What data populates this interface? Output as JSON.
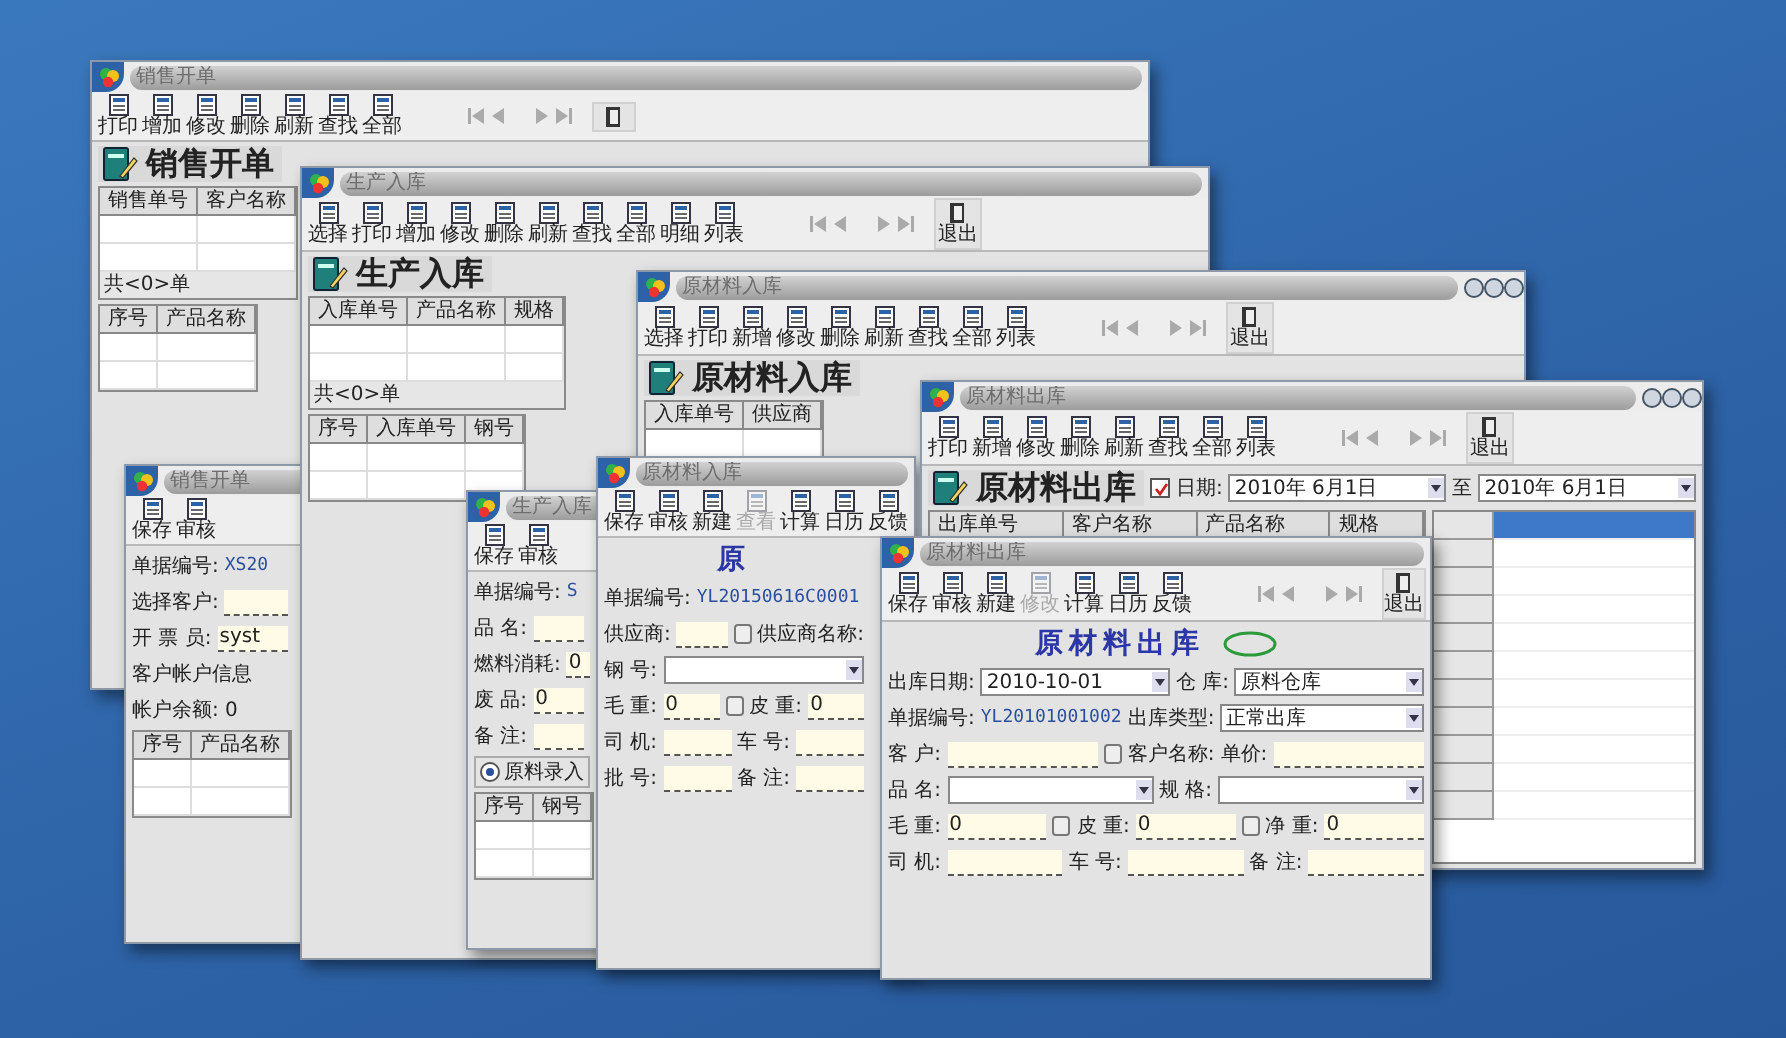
{
  "windows": [
    {
      "title": "销售开单",
      "controls": false,
      "sections": [
        {
          "kind": "toolbar",
          "items": [
            {
              "kind": "button",
              "label": "打印"
            },
            {
              "kind": "button",
              "label": "增加"
            },
            {
              "kind": "button",
              "label": "修改"
            },
            {
              "kind": "button",
              "label": "删除"
            },
            {
              "kind": "button",
              "label": "刷新"
            },
            {
              "kind": "button",
              "label": "查找"
            },
            {
              "kind": "button",
              "label": "全部"
            },
            {
              "kind": "nav"
            },
            {
              "kind": "exit"
            }
          ]
        },
        {
          "kind": "heading",
          "text": "销售开单"
        },
        {
          "kind": "grid",
          "columns": [
            "销售单号",
            "客户名称"
          ],
          "footer": "共<0>单"
        },
        {
          "kind": "grid",
          "columns": [
            "序号",
            "产品名称"
          ]
        }
      ]
    },
    {
      "title": "销售开单",
      "controls": false,
      "sections": [
        {
          "kind": "toolbar",
          "items": [
            {
              "kind": "button",
              "label": "保存"
            },
            {
              "kind": "button",
              "label": "审核"
            }
          ]
        },
        {
          "kind": "fields",
          "rows": [
            {
              "items": [
                {
                  "kind": "label",
                  "text": "单据编号:"
                },
                {
                  "kind": "value",
                  "text": "XS20"
                }
              ]
            },
            {
              "items": [
                {
                  "kind": "label",
                  "text": "选择客户:"
                },
                {
                  "kind": "input"
                }
              ]
            },
            {
              "items": [
                {
                  "kind": "label",
                  "text": "开 票 员:"
                },
                {
                  "kind": "input",
                  "value": "syst"
                }
              ]
            },
            {
              "items": [
                {
                  "kind": "label",
                  "text": "客户帐户信息"
                }
              ]
            },
            {
              "items": [
                {
                  "kind": "label",
                  "text": "帐户余额: 0"
                }
              ]
            }
          ]
        },
        {
          "kind": "grid",
          "columns": [
            "序号",
            "产品名称"
          ]
        }
      ]
    },
    {
      "title": "生产入库",
      "controls": false,
      "sections": [
        {
          "kind": "toolbar",
          "items": [
            {
              "kind": "button",
              "label": "选择"
            },
            {
              "kind": "button",
              "label": "打印"
            },
            {
              "kind": "button",
              "label": "增加"
            },
            {
              "kind": "button",
              "label": "修改"
            },
            {
              "kind": "button",
              "label": "删除"
            },
            {
              "kind": "button",
              "label": "刷新"
            },
            {
              "kind": "button",
              "label": "查找"
            },
            {
              "kind": "button",
              "label": "全部"
            },
            {
              "kind": "button",
              "label": "明细"
            },
            {
              "kind": "button",
              "label": "列表"
            },
            {
              "kind": "nav"
            },
            {
              "kind": "exit",
              "label": "退出"
            }
          ]
        },
        {
          "kind": "heading",
          "text": "生产入库"
        },
        {
          "kind": "grid",
          "columns": [
            "入库单号",
            "产品名称",
            "规格"
          ],
          "footer": "共<0>单"
        },
        {
          "kind": "grid",
          "columns": [
            "序号",
            "入库单号",
            "钢号"
          ]
        }
      ]
    },
    {
      "title": "生产入库",
      "controls": false,
      "sections": [
        {
          "kind": "toolbar",
          "items": [
            {
              "kind": "button",
              "label": "保存"
            },
            {
              "kind": "button",
              "label": "审核"
            }
          ]
        },
        {
          "kind": "fields",
          "rows": [
            {
              "items": [
                {
                  "kind": "label",
                  "text": "单据编号:"
                },
                {
                  "kind": "value",
                  "text": "S"
                }
              ]
            },
            {
              "items": [
                {
                  "kind": "label",
                  "text": "品 名:"
                },
                {
                  "kind": "input"
                }
              ]
            },
            {
              "items": [
                {
                  "kind": "label",
                  "text": "燃料消耗:"
                },
                {
                  "kind": "input",
                  "value": "0"
                }
              ]
            },
            {
              "items": [
                {
                  "kind": "label",
                  "text": "废 品:"
                },
                {
                  "kind": "input",
                  "value": "0"
                }
              ]
            },
            {
              "items": [
                {
                  "kind": "label",
                  "text": "备 注:"
                },
                {
                  "kind": "input"
                }
              ]
            }
          ]
        },
        {
          "kind": "radio",
          "label": "原料录入",
          "checked": true
        },
        {
          "kind": "grid",
          "columns": [
            "序号",
            "钢号"
          ]
        }
      ]
    },
    {
      "title": "原材料入库",
      "controls": true,
      "sections": [
        {
          "kind": "toolbar",
          "items": [
            {
              "kind": "button",
              "label": "选择"
            },
            {
              "kind": "button",
              "label": "打印"
            },
            {
              "kind": "button",
              "label": "新增"
            },
            {
              "kind": "button",
              "label": "修改"
            },
            {
              "kind": "button",
              "label": "删除"
            },
            {
              "kind": "button",
              "label": "刷新"
            },
            {
              "kind": "button",
              "label": "查找"
            },
            {
              "kind": "button",
              "label": "全部"
            },
            {
              "kind": "button",
              "label": "列表"
            },
            {
              "kind": "nav"
            },
            {
              "kind": "exit",
              "label": "退出"
            }
          ]
        },
        {
          "kind": "heading",
          "text": "原材料入库"
        },
        {
          "kind": "grid",
          "columns": [
            "入库单号",
            "供应商"
          ]
        }
      ]
    },
    {
      "title": "原材料入库",
      "controls": false,
      "sections": [
        {
          "kind": "toolbar",
          "items": [
            {
              "kind": "button",
              "label": "保存",
              "disabled": false
            },
            {
              "kind": "button",
              "label": "审核",
              "disabled": false
            },
            {
              "kind": "button",
              "label": "新建",
              "disabled": false
            },
            {
              "kind": "button",
              "label": "查看",
              "disabled": true
            },
            {
              "kind": "button",
              "label": "计算",
              "disabled": false
            },
            {
              "kind": "button",
              "label": "日历",
              "disabled": false
            },
            {
              "kind": "button",
              "label": "反馈",
              "disabled": false
            }
          ]
        },
        {
          "kind": "form_title",
          "text": "原",
          "stamp": false
        },
        {
          "kind": "fields",
          "rows": [
            {
              "items": [
                {
                  "kind": "label",
                  "text": "单据编号:"
                },
                {
                  "kind": "value",
                  "text": "YL20150616C0001"
                }
              ]
            },
            {
              "items": [
                {
                  "kind": "label",
                  "text": "供应商:"
                },
                {
                  "kind": "input"
                },
                {
                  "kind": "button"
                },
                {
                  "kind": "label",
                  "text": "供应商名称:"
                }
              ]
            },
            {
              "items": [
                {
                  "kind": "label",
                  "text": "钢 号:"
                },
                {
                  "kind": "select"
                }
              ]
            },
            {
              "items": [
                {
                  "kind": "label",
                  "text": "毛 重:"
                },
                {
                  "kind": "input",
                  "value": "0"
                },
                {
                  "kind": "button"
                },
                {
                  "kind": "label",
                  "text": "皮 重:"
                },
                {
                  "kind": "input",
                  "value": "0"
                }
              ]
            },
            {
              "items": [
                {
                  "kind": "label",
                  "text": "司 机:"
                },
                {
                  "kind": "input"
                },
                {
                  "kind": "label",
                  "text": "车 号:"
                },
                {
                  "kind": "input"
                }
              ]
            },
            {
              "items": [
                {
                  "kind": "label",
                  "text": "批 号:"
                },
                {
                  "kind": "input"
                },
                {
                  "kind": "label",
                  "text": "备 注:"
                },
                {
                  "kind": "input"
                }
              ]
            }
          ]
        }
      ]
    },
    {
      "title": "原材料出库",
      "controls": true,
      "sections": [
        {
          "kind": "toolbar",
          "items": [
            {
              "kind": "button",
              "label": "打印"
            },
            {
              "kind": "button",
              "label": "新增"
            },
            {
              "kind": "button",
              "label": "修改"
            },
            {
              "kind": "button",
              "label": "删除"
            },
            {
              "kind": "button",
              "label": "刷新"
            },
            {
              "kind": "button",
              "label": "查找"
            },
            {
              "kind": "button",
              "label": "全部"
            },
            {
              "kind": "button",
              "label": "列表"
            },
            {
              "kind": "nav"
            },
            {
              "kind": "exit",
              "label": "退出"
            }
          ]
        },
        {
          "kind": "fields",
          "rows": [
            {
              "items": [
                {
                  "kind": "heading",
                  "text": "原材料出库"
                },
                {
                  "kind": "checkbox",
                  "text": "日期:",
                  "checked": true
                },
                {
                  "kind": "select",
                  "value": "2010年 6月1日"
                },
                {
                  "kind": "label",
                  "text": "至"
                },
                {
                  "kind": "select",
                  "value": "2010年 6月1日"
                }
              ]
            }
          ]
        },
        {
          "kind": "split",
          "columns": [
            "出库单号",
            "客户名称",
            "产品名称",
            "规格"
          ],
          "side": [
            {
              "selected": true
            },
            {
              "selected": false
            },
            {
              "selected": false
            },
            {
              "selected": false
            },
            {
              "selected": false
            },
            {
              "selected": false
            },
            {
              "selected": false
            },
            {
              "selected": false
            },
            {
              "selected": false
            },
            {
              "selected": false
            },
            {
              "selected": false
            }
          ]
        }
      ]
    },
    {
      "title": "原材料出库",
      "controls": false,
      "sections": [
        {
          "kind": "toolbar",
          "items": [
            {
              "kind": "button",
              "label": "保存",
              "disabled": false
            },
            {
              "kind": "button",
              "label": "审核",
              "disabled": false
            },
            {
              "kind": "button",
              "label": "新建",
              "disabled": false
            },
            {
              "kind": "button",
              "label": "修改",
              "disabled": true
            },
            {
              "kind": "button",
              "label": "计算",
              "disabled": false
            },
            {
              "kind": "button",
              "label": "日历",
              "disabled": false
            },
            {
              "kind": "button",
              "label": "反馈",
              "disabled": false
            },
            {
              "kind": "nav"
            },
            {
              "kind": "exit",
              "label": "退出"
            }
          ]
        },
        {
          "kind": "form_title",
          "text": "原材料出库",
          "stamp": true
        },
        {
          "kind": "fields",
          "rows": [
            {
              "items": [
                {
                  "kind": "label",
                  "text": "出库日期:"
                },
                {
                  "kind": "select",
                  "value": "2010-10-01"
                },
                {
                  "kind": "label",
                  "text": "仓 库:"
                },
                {
                  "kind": "select",
                  "value": "原料仓库"
                }
              ]
            },
            {
              "items": [
                {
                  "kind": "label",
                  "text": "单据编号:"
                },
                {
                  "kind": "value",
                  "text": "YL20101001002"
                },
                {
                  "kind": "label",
                  "text": "出库类型:"
                },
                {
                  "kind": "select",
                  "value": "正常出库"
                }
              ]
            },
            {
              "items": [
                {
                  "kind": "label",
                  "text": "客 户:"
                },
                {
                  "kind": "input"
                },
                {
                  "kind": "button"
                },
                {
                  "kind": "label",
                  "text": "客户名称:"
                },
                {
                  "kind": "label",
                  "text": "单价:"
                },
                {
                  "kind": "input"
                }
              ]
            },
            {
              "items": [
                {
                  "kind": "label",
                  "text": "品 名:"
                },
                {
                  "kind": "select"
                },
                {
                  "kind": "label",
                  "text": "规 格:"
                },
                {
                  "kind": "select"
                }
              ]
            },
            {
              "items": [
                {
                  "kind": "label",
                  "text": "毛 重:"
                },
                {
                  "kind": "input",
                  "value": "0"
                },
                {
                  "kind": "button"
                },
                {
                  "kind": "label",
                  "text": "皮 重:"
                },
                {
                  "kind": "input",
                  "value": "0"
                },
                {
                  "kind": "button"
                },
                {
                  "kind": "label",
                  "text": "净 重:"
                },
                {
                  "kind": "input",
                  "value": "0"
                }
              ]
            },
            {
              "items": [
                {
                  "kind": "label",
                  "text": "司 机:"
                },
                {
                  "kind": "input"
                },
                {
                  "kind": "label",
                  "text": "车 号:"
                },
                {
                  "kind": "input"
                },
                {
                  "kind": "label",
                  "text": "备 注:"
                },
                {
                  "kind": "input"
                }
              ]
            }
          ]
        }
      ]
    }
  ]
}
